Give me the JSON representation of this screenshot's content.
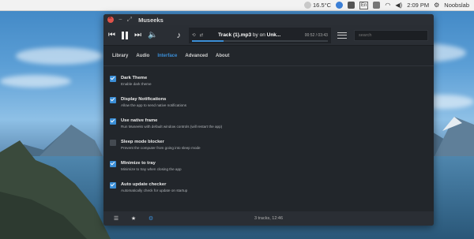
{
  "panel": {
    "temperature": "16.5°C",
    "keyboard": "En",
    "time": "2:09 PM",
    "user": "Noobslab"
  },
  "window": {
    "title": "Museeks"
  },
  "player": {
    "track_title": "Track (1).mp3",
    "by_label": "by",
    "on_label": "on",
    "album": "Unk...",
    "time": "00:52 / 03:43",
    "progress": 0.23,
    "search_placeholder": "search"
  },
  "tabs": [
    {
      "label": "Library",
      "active": false
    },
    {
      "label": "Audio",
      "active": false
    },
    {
      "label": "Interface",
      "active": true
    },
    {
      "label": "Advanced",
      "active": false
    },
    {
      "label": "About",
      "active": false
    }
  ],
  "settings": [
    {
      "title": "Dark Theme",
      "desc": "Enable dark theme",
      "checked": true
    },
    {
      "title": "Display Notifications",
      "desc": "Allow the app to send native notifications",
      "checked": true
    },
    {
      "title": "Use native frame",
      "desc": "Run Museeks with default window controls (will restart the app)",
      "checked": true
    },
    {
      "title": "Sleep mode blocker",
      "desc": "Prevent the computer from going into sleep mode",
      "checked": false
    },
    {
      "title": "Minimize to tray",
      "desc": "Minimize to tray when closing the app",
      "checked": true
    },
    {
      "title": "Auto update checker",
      "desc": "Automatically check for update on startup",
      "checked": true
    }
  ],
  "footer": {
    "status": "3 tracks, 12:46"
  },
  "colors": {
    "accent": "#3b8ed6",
    "window_bg": "#22262b",
    "close": "#e0534a"
  }
}
